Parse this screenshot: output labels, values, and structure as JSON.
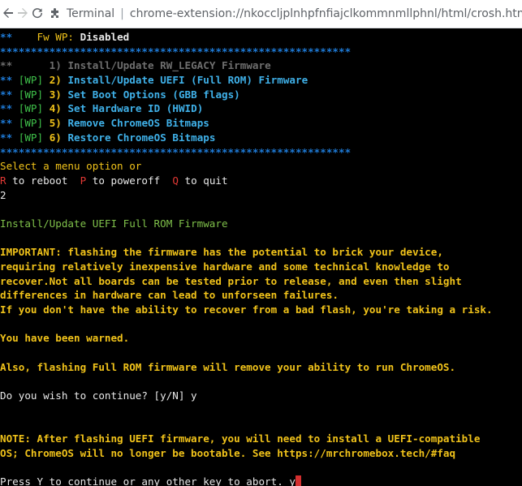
{
  "browser": {
    "site_name": "Terminal",
    "url": "chrome-extension://nkoccljplnhpfnfiajclkommnmllphnl/html/crosh.html",
    "back_icon": "arrow-left-icon",
    "forward_icon": "arrow-right-icon",
    "reload_icon": "reload-icon"
  },
  "terminal": {
    "fw_wp_prefix": "**",
    "fw_wp_label": "Fw WP:",
    "fw_wp_value": "Disabled",
    "divider": "*********************************************************",
    "menu": [
      {
        "prefix": "**",
        "tag": "",
        "num": "1)",
        "label": "Install/Update RW_LEGACY Firmware",
        "enabled": false
      },
      {
        "prefix": "**",
        "tag": "[WP]",
        "num": "2)",
        "label": "Install/Update UEFI (Full ROM) Firmware",
        "enabled": true
      },
      {
        "prefix": "**",
        "tag": "[WP]",
        "num": "3)",
        "label": "Set Boot Options (GBB flags)",
        "enabled": true
      },
      {
        "prefix": "**",
        "tag": "[WP]",
        "num": "4)",
        "label": "Set Hardware ID (HWID)",
        "enabled": true
      },
      {
        "prefix": "**",
        "tag": "[WP]",
        "num": "5)",
        "label": "Remove ChromeOS Bitmaps",
        "enabled": true
      },
      {
        "prefix": "**",
        "tag": "[WP]",
        "num": "6)",
        "label": "Restore ChromeOS Bitmaps",
        "enabled": true
      }
    ],
    "select_prompt": "Select a menu option or",
    "reboot_key": "R",
    "reboot_text": " to reboot  ",
    "poweroff_key": "P",
    "poweroff_text": " to poweroff  ",
    "quit_key": "Q",
    "quit_text": " to quit",
    "user_choice": "2",
    "section_title": "Install/Update UEFI Full ROM Firmware",
    "warning_lines": [
      "IMPORTANT: flashing the firmware has the potential to brick your device,",
      "requiring relatively inexpensive hardware and some technical knowledge to",
      "recover.Not all boards can be tested prior to release, and even then slight",
      "differences in hardware can lead to unforseen failures.",
      "If you don't have the ability to recover from a bad flash, you're taking a risk."
    ],
    "warned": "You have been warned.",
    "also_warning": "Also, flashing Full ROM firmware will remove your ability to run ChromeOS.",
    "continue_prompt": "Do you wish to continue? [y/N] y",
    "note_lines": [
      "NOTE: After flashing UEFI firmware, you will need to install a UEFI-compatible",
      "OS; ChromeOS will no longer be bootable. See https://mrchromebox.tech/#faq"
    ],
    "final_prompt": "Press Y to continue or any other key to abort. y"
  }
}
